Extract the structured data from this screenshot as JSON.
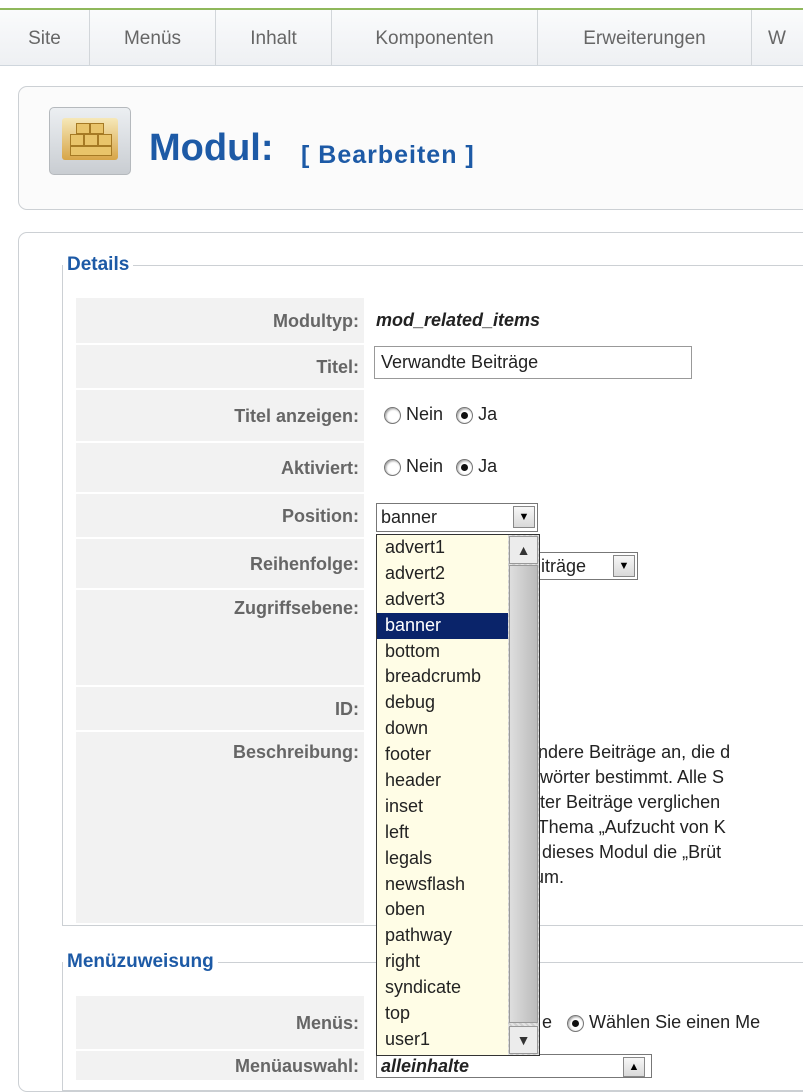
{
  "menu": {
    "items": [
      "Site",
      "Menüs",
      "Inhalt",
      "Komponenten",
      "Erweiterungen",
      "W"
    ]
  },
  "header": {
    "title": "Modul:",
    "subtitle": "[ Bearbeiten ]"
  },
  "details": {
    "legend": "Details",
    "moduletype_label": "Modultyp:",
    "moduletype_value": "mod_related_items",
    "title_label": "Titel:",
    "title_value": "Verwandte Beiträge",
    "show_title_label": "Titel anzeigen:",
    "show_title_no": "Nein",
    "show_title_yes": "Ja",
    "enabled_label": "Aktiviert:",
    "enabled_no": "Nein",
    "enabled_yes": "Ja",
    "position_label": "Position:",
    "position_value": "banner",
    "order_label": "Reihenfolge:",
    "order_value_fragment": "iträge",
    "access_label": "Zugriffsebene:",
    "id_label": "ID:",
    "description_label": "Beschreibung:",
    "description_fragments": [
      "gt andere Beiträge an, die d",
      "sselwörter bestimmt. Alle S",
      "tlichter Beiträge verglichen",
      "um Thema „Aufzucht von K",
      "ählt dieses Modul die „Brüt",
      "herum."
    ]
  },
  "dropdown": {
    "options": [
      "advert1",
      "advert2",
      "advert3",
      "banner",
      "bottom",
      "breadcrumb",
      "debug",
      "down",
      "footer",
      "header",
      "inset",
      "left",
      "legals",
      "newsflash",
      "oben",
      "pathway",
      "right",
      "syndicate",
      "top",
      "user1"
    ],
    "selected": "banner"
  },
  "menu_assignment": {
    "legend": "Menüzuweisung",
    "menus_label": "Menüs:",
    "menus_option_fragment": "e",
    "menus_option_select": "Wählen Sie einen Me",
    "selection_label": "Menüauswahl:",
    "selection_value": "alleinhalte"
  },
  "colors": {
    "accent": "#1d5aa6",
    "selection": "#0a246a",
    "option_bg": "#fffde6"
  }
}
